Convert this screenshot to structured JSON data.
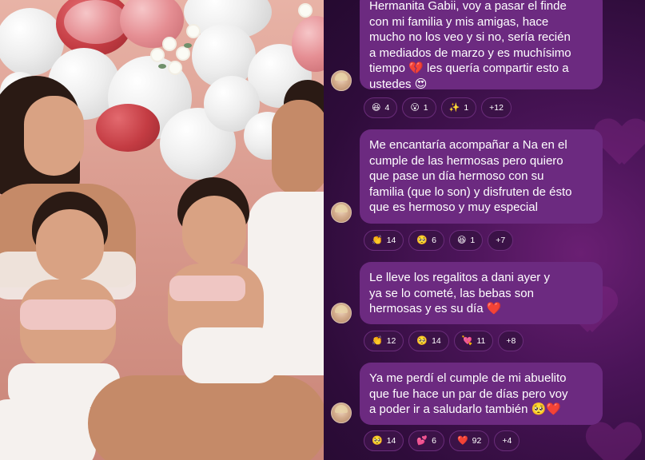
{
  "post": {
    "photo_alt": "",
    "messages": [
      {
        "text_lines": [
          "Hermanita Gabii, voy a pasar el finde",
          "con mi familia y mis amigas, hace",
          "mucho no los veo y si no, sería recién",
          "a mediados de marzo y es muchísimo",
          "tiempo 💔 les quería compartir esto a",
          "ustedes 😍"
        ],
        "reactions": [
          {
            "emoji": "😆",
            "count": "4"
          },
          {
            "emoji": "😮",
            "count": "1"
          },
          {
            "emoji": "✨",
            "count": "1"
          },
          {
            "emoji": "",
            "count": "+12"
          }
        ]
      },
      {
        "text_lines": [
          "Me encantaría acompañar a Na en el",
          "cumple de las hermosas pero quiero",
          "que pase un día hermoso con su",
          "familia (que lo son) y disfruten de ésto",
          "que es hermoso y muy especial"
        ],
        "reactions": [
          {
            "emoji": "👏",
            "count": "14"
          },
          {
            "emoji": "🥺",
            "count": "6"
          },
          {
            "emoji": "😆",
            "count": "1"
          },
          {
            "emoji": "",
            "count": "+7"
          }
        ]
      },
      {
        "text_lines": [
          "Le lleve los regalitos a dani ayer y",
          "ya se lo cometé, las bebas son",
          "hermosas y es su día ❤️"
        ],
        "reactions": [
          {
            "emoji": "👏",
            "count": "12"
          },
          {
            "emoji": "🥺",
            "count": "14"
          },
          {
            "emoji": "💘",
            "count": "11"
          },
          {
            "emoji": "",
            "count": "+8"
          }
        ]
      },
      {
        "text_lines": [
          "Ya me perdí el cumple de mi abuelito",
          "que fue hace un par de días pero voy",
          "a poder ir a saludarlo también 🥺❤️"
        ],
        "reactions": [
          {
            "emoji": "🥺",
            "count": "14"
          },
          {
            "emoji": "💕",
            "count": "6"
          },
          {
            "emoji": "❤️",
            "count": "92"
          },
          {
            "emoji": "",
            "count": "+4"
          }
        ]
      }
    ]
  }
}
